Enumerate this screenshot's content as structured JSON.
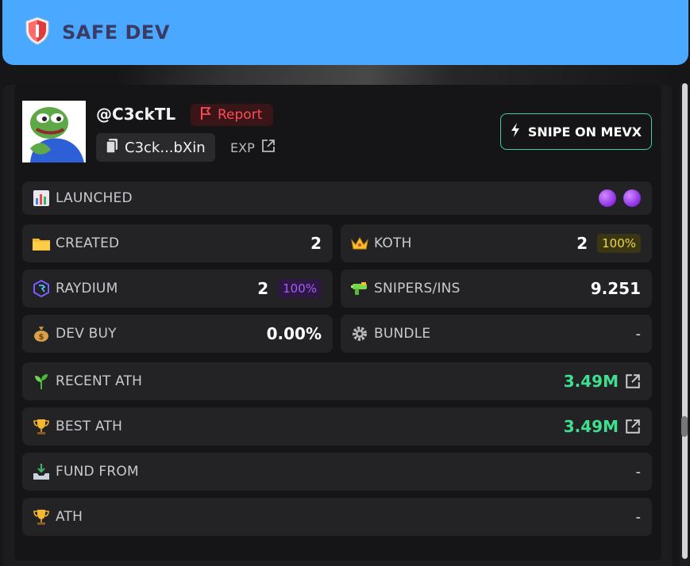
{
  "banner": {
    "title": "SAFE DEV"
  },
  "profile": {
    "handle": "@C3ckTL",
    "report_label": "Report",
    "address": "C3ck...bXin",
    "exp_label": "EXP",
    "snipe_label": "SNIPE ON MEVX"
  },
  "rows": {
    "launched": {
      "label": "LAUNCHED"
    },
    "created": {
      "label": "CREATED",
      "value": "2"
    },
    "koth": {
      "label": "KOTH",
      "value": "2",
      "pct": "100%"
    },
    "raydium": {
      "label": "RAYDIUM",
      "value": "2",
      "pct": "100%"
    },
    "snipers": {
      "label": "SNIPERS/INS",
      "value": "9.251"
    },
    "dev_buy": {
      "label": "DEV BUY",
      "value": "0.00%"
    },
    "bundle": {
      "label": "BUNDLE",
      "value": "-"
    },
    "recent_ath": {
      "label": "RECENT ATH",
      "value": "3.49M"
    },
    "best_ath": {
      "label": "BEST ATH",
      "value": "3.49M"
    },
    "fund_from": {
      "label": "FUND FROM",
      "value": "-"
    },
    "ath": {
      "label": "ATH",
      "value": "-"
    }
  },
  "colors": {
    "banner": "#4aa8ff",
    "accent_green": "#3ee08f",
    "report_red": "#ff4a55",
    "pct_yellow": "#f0d74a",
    "pct_purple": "#a45cff"
  },
  "icons": {
    "banner": "shield-icon",
    "report": "flag-icon",
    "address": "copy-icon",
    "exp": "external-link-icon",
    "snipe": "lightning-icon",
    "launched": "chart-icon",
    "created": "folder-icon",
    "koth": "crown-icon",
    "raydium": "raydium-icon",
    "snipers": "water-gun-icon",
    "dev_buy": "money-bag-icon",
    "bundle": "gear-icon",
    "recent_ath": "seedling-icon",
    "best_ath": "trophy-icon",
    "fund_from": "inbox-tray-icon",
    "ath": "trophy-icon"
  }
}
